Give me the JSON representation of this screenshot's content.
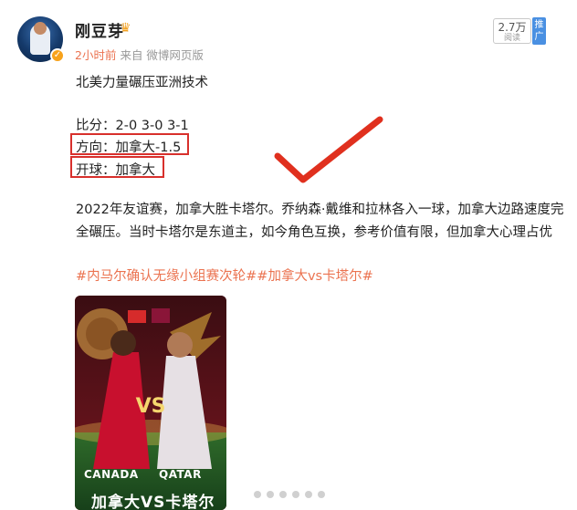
{
  "post": {
    "username": "刚豆芽",
    "time": "2小时前",
    "source": "来自 微博网页版",
    "views_count": "2.7万",
    "views_label": "阅读",
    "promote_label": "推广"
  },
  "content": {
    "headline": "北美力量碾压亚洲技术",
    "score_line": "比分：2-0 3-0 3-1",
    "direction_line": "方向：加拿大-1.5",
    "kickoff_line": "开球：加拿大",
    "paragraph": "2022年友谊赛，加拿大胜卡塔尔。乔纳森·戴维和拉林各入一球，加拿大边路速度完全碾压。当时卡塔尔是东道主，如今角色互换，参考价值有限，但加拿大心理占优",
    "hashtags": "#内马尔确认无缘小组赛次轮##加拿大vs卡塔尔#"
  },
  "poster": {
    "team_left": "CANADA",
    "team_right": "QATAR",
    "title_cn": "加拿大VS卡塔尔",
    "vs": "VS"
  },
  "colors": {
    "accent_orange": "#eb7350",
    "highlight_red": "#d8302c",
    "promo_blue": "#4a90e2"
  }
}
